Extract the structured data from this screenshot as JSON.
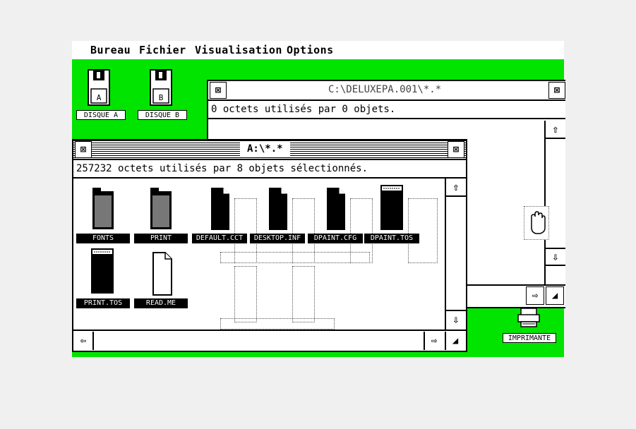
{
  "menubar": {
    "items": [
      "Bureau",
      "Fichier",
      "Visualisation",
      "Options"
    ]
  },
  "desktop": {
    "color": "#00e400",
    "icons": [
      {
        "label": "DISQUE A"
      },
      {
        "label": "DISQUE B"
      },
      {
        "label": "IMPRIMANTE"
      }
    ]
  },
  "back_window": {
    "title": "C:\\DELUXEPA.001\\*.*",
    "info": "0 octets utilisés par 0 objets.",
    "close_symbol": "⊠",
    "full_symbol": "⊠",
    "scroll_up": "⇧",
    "scroll_down": "⇩",
    "scroll_right": "⇨",
    "size_symbol": "◢"
  },
  "front_window": {
    "title": "A:\\*.*",
    "info": "257232 octets utilisés par 8 objets sélectionnés.",
    "close_symbol": "⊠",
    "full_symbol": "⊠",
    "scroll_up": "⇧",
    "scroll_down": "⇩",
    "scroll_left": "⇦",
    "scroll_right": "⇨",
    "size_symbol": "◢",
    "files": [
      {
        "name": "FONTS",
        "kind": "folder"
      },
      {
        "name": "PRINT",
        "kind": "folder"
      },
      {
        "name": "DEFAULT.CCT",
        "kind": "file"
      },
      {
        "name": "DESKTOP.INF",
        "kind": "file"
      },
      {
        "name": "DPAINT.CFG",
        "kind": "file"
      },
      {
        "name": "DPAINT.TOS",
        "kind": "program"
      },
      {
        "name": "PRINT.TOS",
        "kind": "program"
      },
      {
        "name": "READ.ME",
        "kind": "file-white"
      }
    ]
  },
  "cursor": {
    "icon": "hand-pointer"
  }
}
